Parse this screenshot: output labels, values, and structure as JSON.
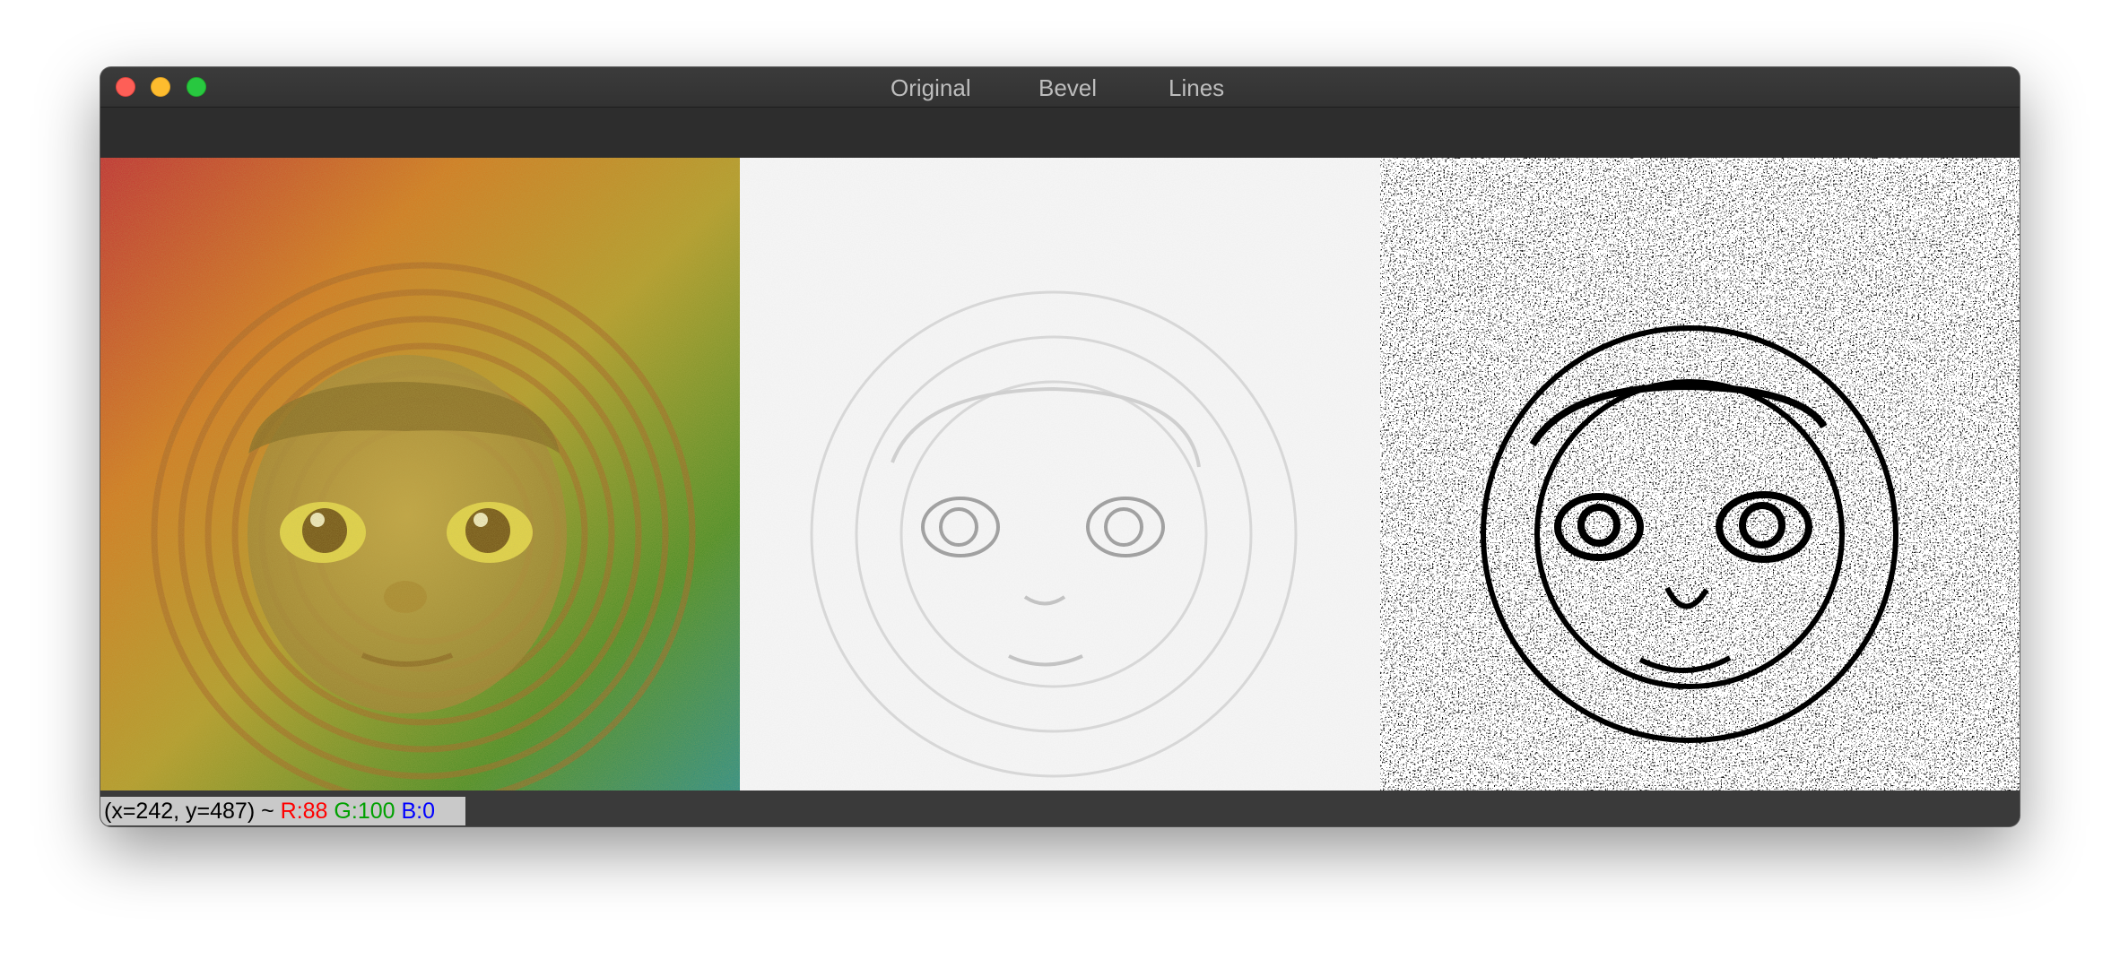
{
  "window": {
    "tabs": [
      {
        "label": "Original"
      },
      {
        "label": "Bevel"
      },
      {
        "label": "Lines"
      }
    ]
  },
  "panels": {
    "original": {
      "name": "Original"
    },
    "bevel": {
      "name": "Bevel"
    },
    "lines": {
      "name": "Lines"
    }
  },
  "status": {
    "coords": "(x=242, y=487) ~ ",
    "r": "R:88",
    "g": "G:100",
    "b": "B:0"
  },
  "colors": {
    "close": "#fe5f57",
    "minimize": "#febc2e",
    "zoom": "#28c840",
    "r_text": "#ff0000",
    "g_text": "#00a000",
    "b_text": "#0000ff"
  }
}
